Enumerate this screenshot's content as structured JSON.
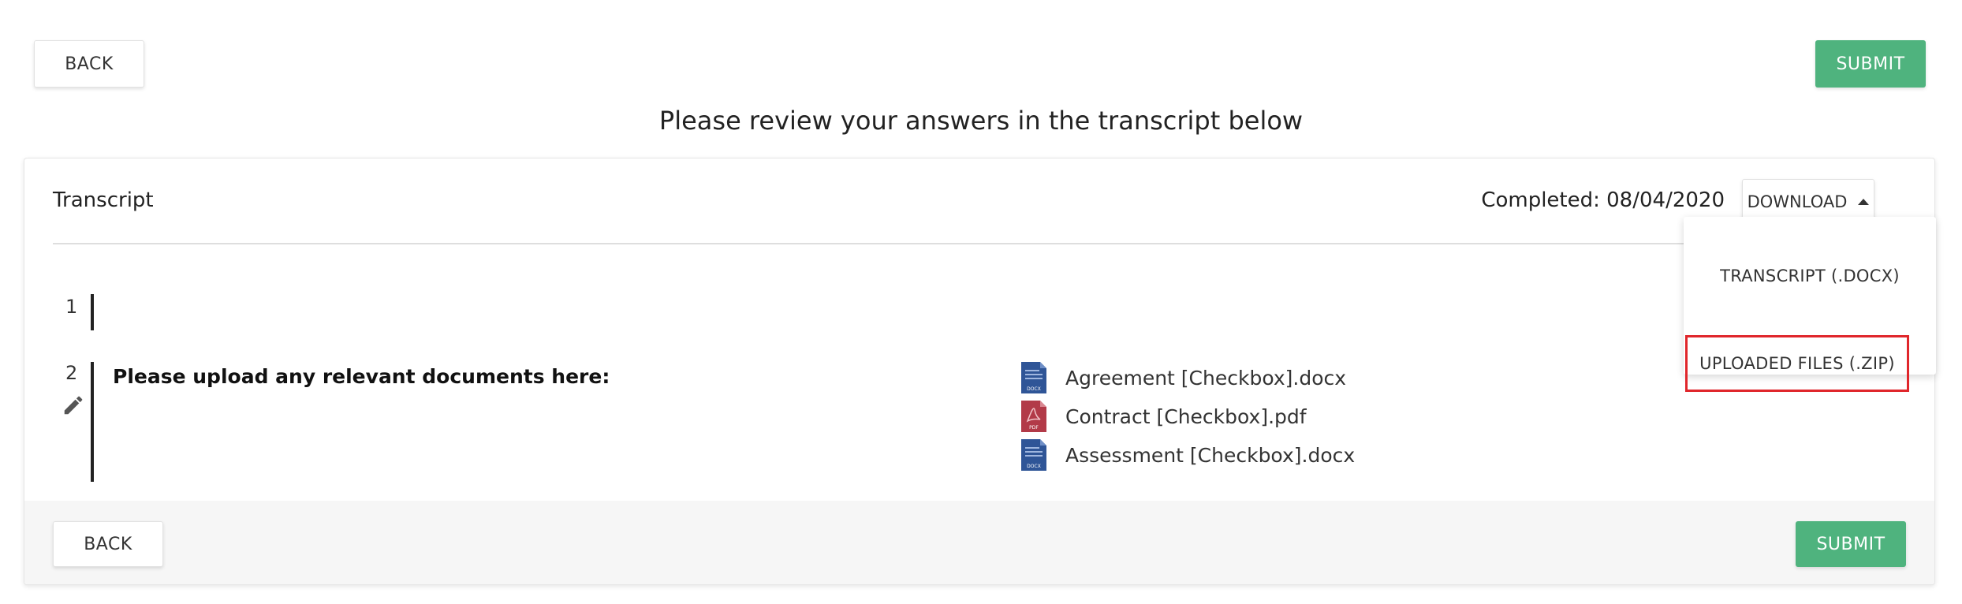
{
  "toolbar": {
    "back_label": "BACK",
    "submit_label": "SUBMIT"
  },
  "heading": "Please review your answers in the transcript below",
  "card": {
    "title": "Transcript",
    "completed": "Completed: 08/04/2020",
    "download_label": "DOWNLOAD",
    "dropdown": {
      "items": [
        {
          "label": "TRANSCRIPT (.DOCX)"
        },
        {
          "label": "UPLOADED FILES (.ZIP)"
        }
      ]
    },
    "rows": [
      {
        "number": "1"
      },
      {
        "number": "2",
        "question": "Please upload any relevant documents here:"
      }
    ],
    "files": [
      {
        "name": "Agreement [Checkbox].docx",
        "type": "DOCX",
        "icon": "docx-file-icon"
      },
      {
        "name": "Contract [Checkbox].pdf",
        "type": "PDF",
        "icon": "pdf-file-icon"
      },
      {
        "name": "Assessment [Checkbox].docx",
        "type": "DOCX",
        "icon": "docx-file-icon"
      }
    ],
    "footer": {
      "back_label": "BACK",
      "submit_label": "SUBMIT"
    }
  },
  "colors": {
    "submit": "#4fb37e",
    "highlight": "#e0262b",
    "docx": "#2f5597",
    "pdf": "#b23a48"
  }
}
